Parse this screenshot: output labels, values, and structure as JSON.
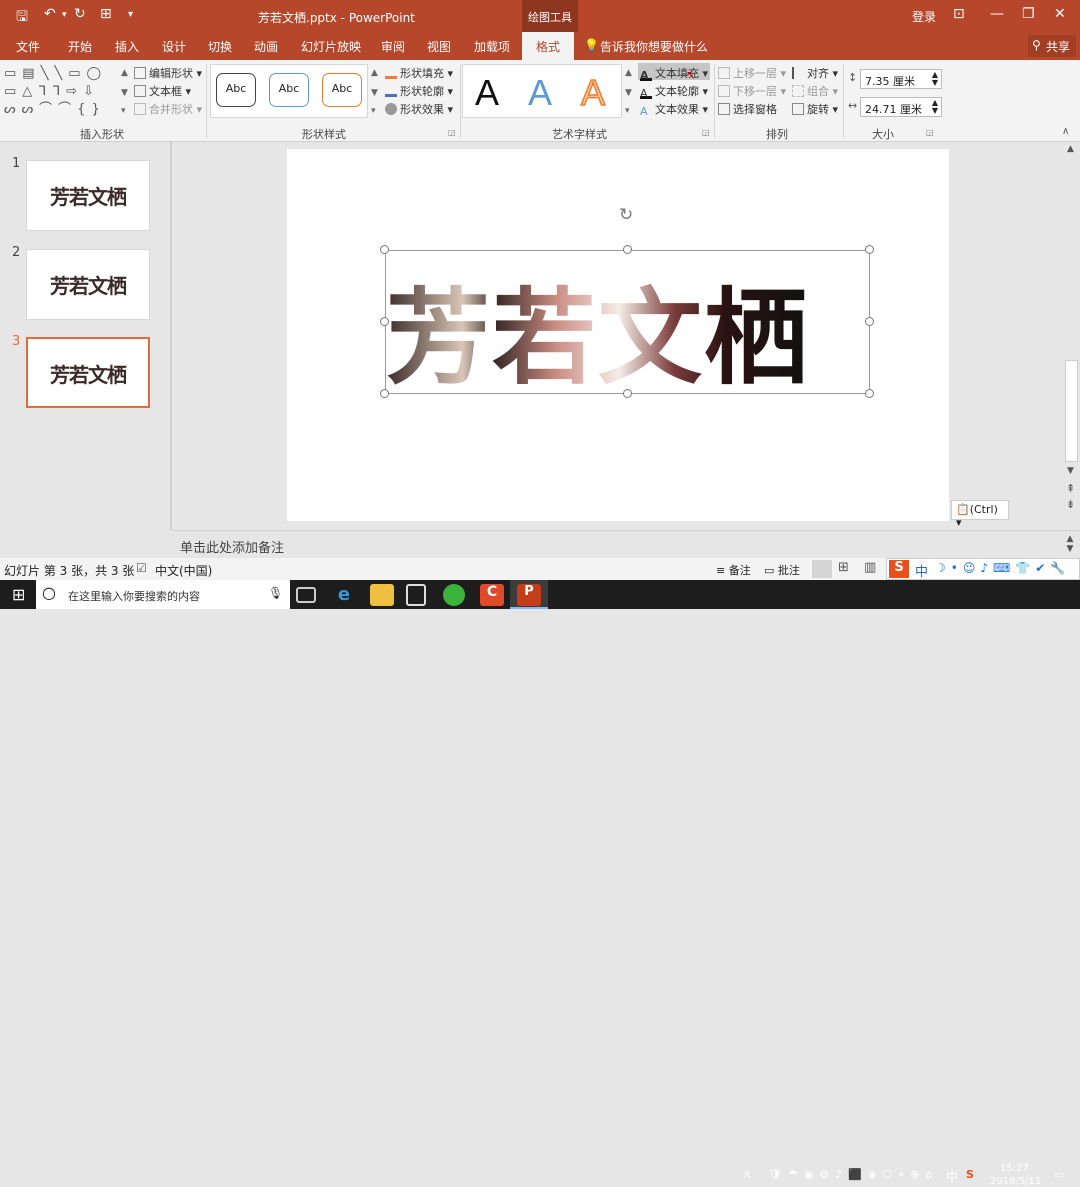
{
  "window": {
    "title": "芳若文栖.pptx - PowerPoint",
    "context_tool": "绘图工具",
    "login": "登录",
    "share": "共享"
  },
  "tabs": [
    "文件",
    "开始",
    "插入",
    "设计",
    "切换",
    "动画",
    "幻灯片放映",
    "审阅",
    "视图",
    "加载项",
    "格式"
  ],
  "active_tab": "格式",
  "tell_me": "告诉我你想要做什么",
  "ribbon": {
    "insert_shapes": {
      "label": "插入形状",
      "edit_shape": "编辑形状",
      "text_box": "文本框",
      "merge_shapes": "合并形状"
    },
    "shape_styles": {
      "label": "形状样式",
      "style_sample": "Abc",
      "fill": "形状填充",
      "outline": "形状轮廓",
      "effects": "形状效果"
    },
    "wordart": {
      "label": "艺术字样式",
      "sample": "A",
      "text_fill": "文本填充",
      "text_outline": "文本轮廓",
      "text_effects": "文本效果"
    },
    "arrange": {
      "label": "排列",
      "bring_forward": "上移一层",
      "send_backward": "下移一层",
      "selection_pane": "选择窗格",
      "align": "对齐",
      "group": "组合",
      "rotate": "旋转"
    },
    "size": {
      "label": "大小",
      "height": "7.35 厘米",
      "width": "24.71 厘米"
    }
  },
  "slides": [
    {
      "number": "1",
      "text": "芳若文栖"
    },
    {
      "number": "2",
      "text": "芳若文栖"
    },
    {
      "number": "3",
      "text": "芳若文栖"
    }
  ],
  "selected_slide": 3,
  "slide_text": "芳若文栖",
  "paste_options": "(Ctrl)",
  "notes_placeholder": "单击此处添加备注",
  "status": {
    "slide_info": "幻灯片 第 3 张，共 3 张",
    "language": "中文(中国)",
    "notes": "备注",
    "comments": "批注"
  },
  "taskbar": {
    "search_placeholder": "在这里输入你要搜索的内容",
    "time": "15:27",
    "date": "2018/5/11",
    "ime": "中"
  },
  "colors": {
    "accent": "#b7472a",
    "selection": "#e06c3c"
  }
}
